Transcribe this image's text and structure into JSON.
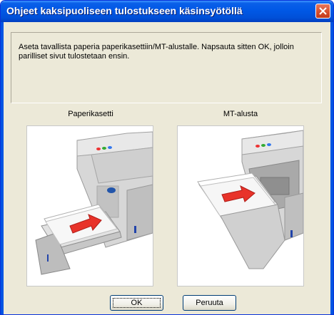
{
  "window": {
    "title": "Ohjeet kaksipuoliseen tulostukseen käsinsyötöllä",
    "close_icon": "close-icon"
  },
  "message": "Aseta tavallista paperia paperikasettiin/MT-alustalle. Napsauta sitten OK, jolloin parilliset sivut tulostetaan ensin.",
  "panels": [
    {
      "caption": "Paperikasetti",
      "image": "printer-paper-tray-illustration"
    },
    {
      "caption": "MT-alusta",
      "image": "printer-mp-tray-illustration"
    }
  ],
  "buttons": {
    "ok_label": "OK",
    "cancel_label": "Peruuta"
  },
  "colors": {
    "title_bar": "#0058e6",
    "dialog_bg": "#ece9d8",
    "close_button": "#d44c2a",
    "arrow": "#e8332a"
  }
}
